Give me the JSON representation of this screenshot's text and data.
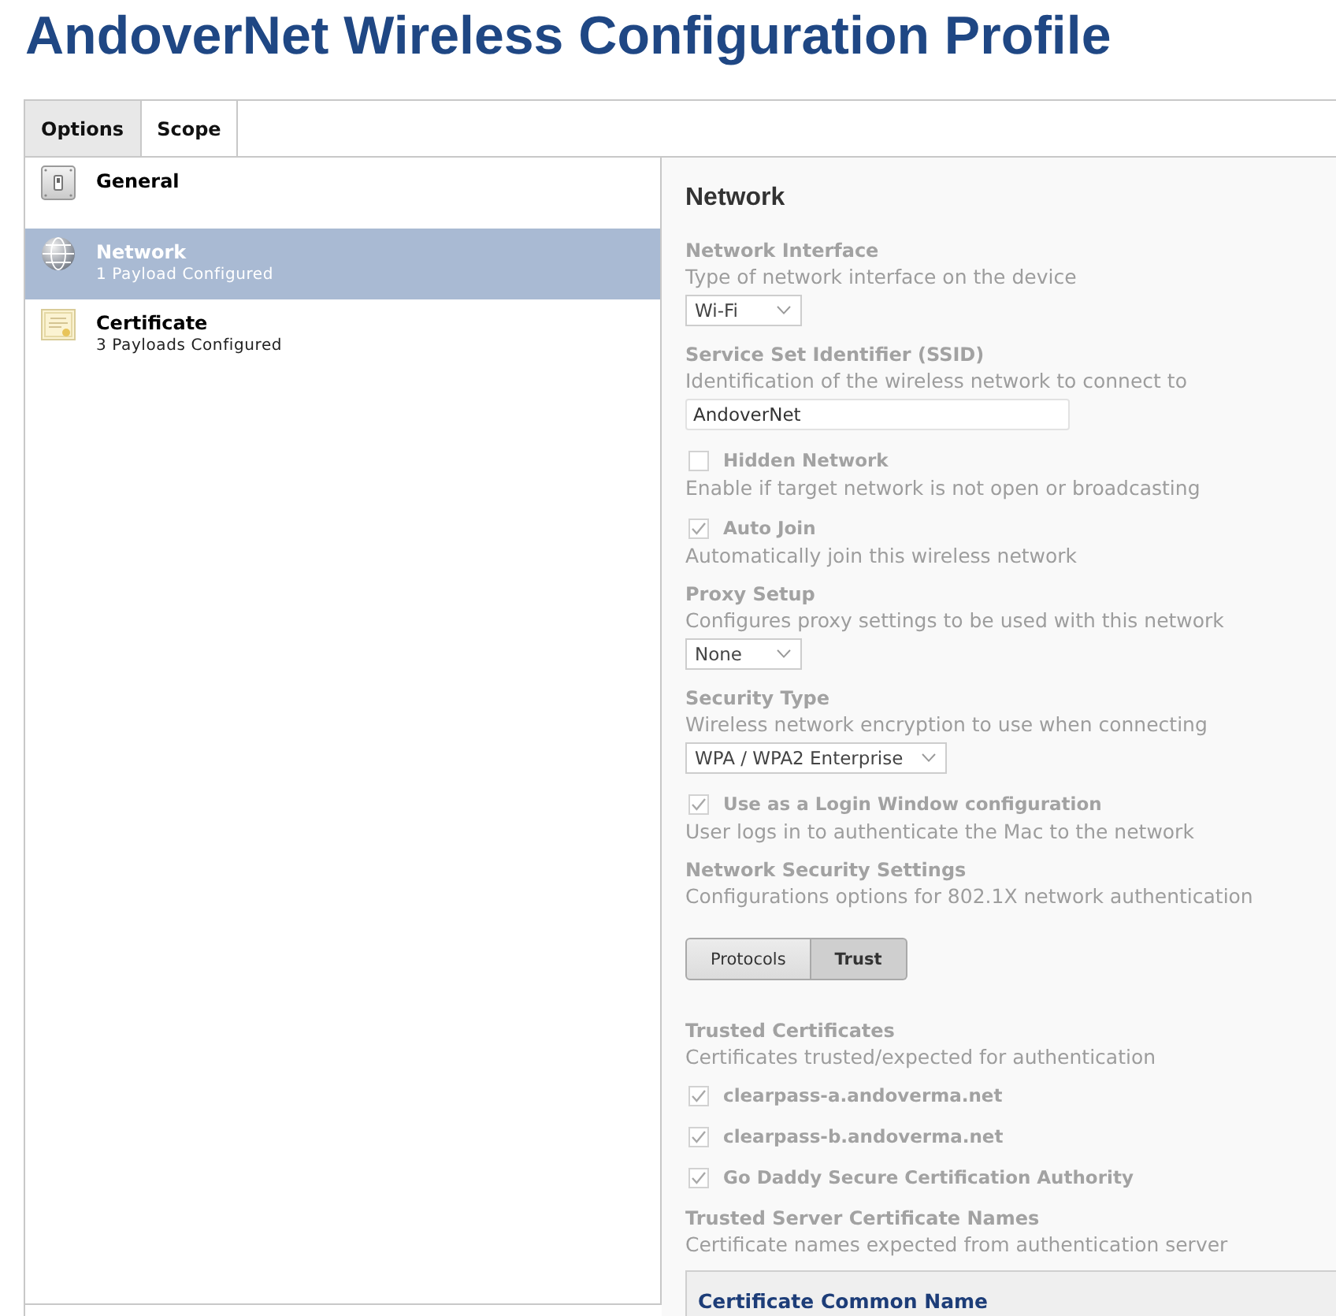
{
  "title": "AndoverNet Wireless Configuration Profile",
  "tabs": [
    {
      "label": "Options",
      "selected": true
    },
    {
      "label": "Scope",
      "selected": false
    }
  ],
  "payloads": [
    {
      "kind": "general",
      "name": "General",
      "selected": false
    },
    {
      "kind": "network",
      "name": "Network",
      "subtitle": "1 Payload Configured",
      "selected": true
    },
    {
      "kind": "certificate",
      "name": "Certificate",
      "subtitle": "3 Payloads Configured",
      "selected": false
    }
  ],
  "panel": {
    "heading": "Network",
    "disabled": true,
    "settings": [
      {
        "kind": "select",
        "label": "Network Interface",
        "description": "Type of network interface on the device",
        "value": "Wi-Fi"
      },
      {
        "kind": "text",
        "label": "Service Set Identifier (SSID)",
        "description": "Identification of the wireless network to connect to",
        "value": "AndoverNet"
      },
      {
        "kind": "checkbox",
        "label": "Hidden Network",
        "checked": false,
        "description": "Enable if target network is not open or broadcasting"
      },
      {
        "kind": "checkbox",
        "label": "Auto Join",
        "checked": true,
        "description": "Automatically join this wireless network"
      },
      {
        "kind": "select",
        "label": "Proxy Setup",
        "description": "Configures proxy settings to be used with this network",
        "value": "None"
      },
      {
        "kind": "select",
        "label": "Security Type",
        "description": "Wireless network encryption to use when connecting",
        "value": "WPA / WPA2 Enterprise"
      },
      {
        "kind": "checkbox",
        "label": "Use as a Login Window configuration",
        "checked": true,
        "description": "User logs in to authenticate the Mac to the network"
      },
      {
        "kind": "info",
        "label": "Network Security Settings",
        "description": "Configurations options for 802.1X network authentication"
      },
      {
        "kind": "segmented",
        "options": [
          {
            "label": "Protocols",
            "selected": false
          },
          {
            "label": "Trust",
            "selected": true
          }
        ]
      },
      {
        "kind": "checklist",
        "label": "Trusted Certificates",
        "description": "Certificates trusted/expected for authentication",
        "items": [
          {
            "label": "clearpass-a.andoverma.net",
            "checked": true
          },
          {
            "label": "clearpass-b.andoverma.net",
            "checked": true
          },
          {
            "label": "Go Daddy Secure Certification Authority",
            "checked": true
          }
        ]
      },
      {
        "kind": "table",
        "label": "Trusted Server Certificate Names",
        "description": "Certificate names expected from authentication server",
        "columns": [
          "Certificate Common Name"
        ]
      }
    ]
  }
}
